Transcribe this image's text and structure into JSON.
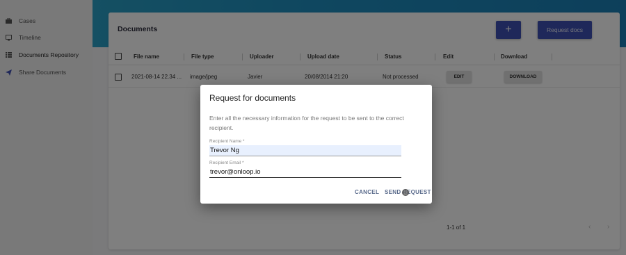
{
  "sidebar": {
    "items": [
      {
        "label": "Cases",
        "icon": "briefcase-icon"
      },
      {
        "label": "Timeline",
        "icon": "monitor-icon"
      },
      {
        "label": "Documents Repository",
        "icon": "list-icon"
      },
      {
        "label": "Share Documents",
        "icon": "send-icon"
      }
    ]
  },
  "documents": {
    "title": "Documents",
    "add_label": "+",
    "request_docs_label": "Request docs",
    "columns": [
      "File name",
      "File type",
      "Uploader",
      "Upload date",
      "Status",
      "Edit",
      "Download"
    ],
    "rows": [
      {
        "file_name": "2021-08-14 22.34 ...",
        "file_type": "image/jpeg",
        "uploader": "Javier",
        "upload_date": "20/08/2014 21:20",
        "status": "Not processed",
        "edit_label": "EDIT",
        "download_label": "DOWNLOAD"
      }
    ],
    "pagination": {
      "range": "1-1 of 1",
      "prev": "‹",
      "next": "›"
    }
  },
  "dialog": {
    "title": "Request for documents",
    "description": "Enter all the necessary information for the request to be sent to the correct recipient.",
    "name_label": "Recipient Name *",
    "name_value": "Trevor Ng",
    "email_label": "Recipient Email *",
    "email_value": "trevor@onloop.io",
    "cancel_label": "CANCEL",
    "send_label": "SEND REQUEST"
  },
  "colors": {
    "primary": "#3f51b5",
    "header_gradient_start": "#2aa0c6",
    "header_gradient_end": "#1a7fb6"
  }
}
